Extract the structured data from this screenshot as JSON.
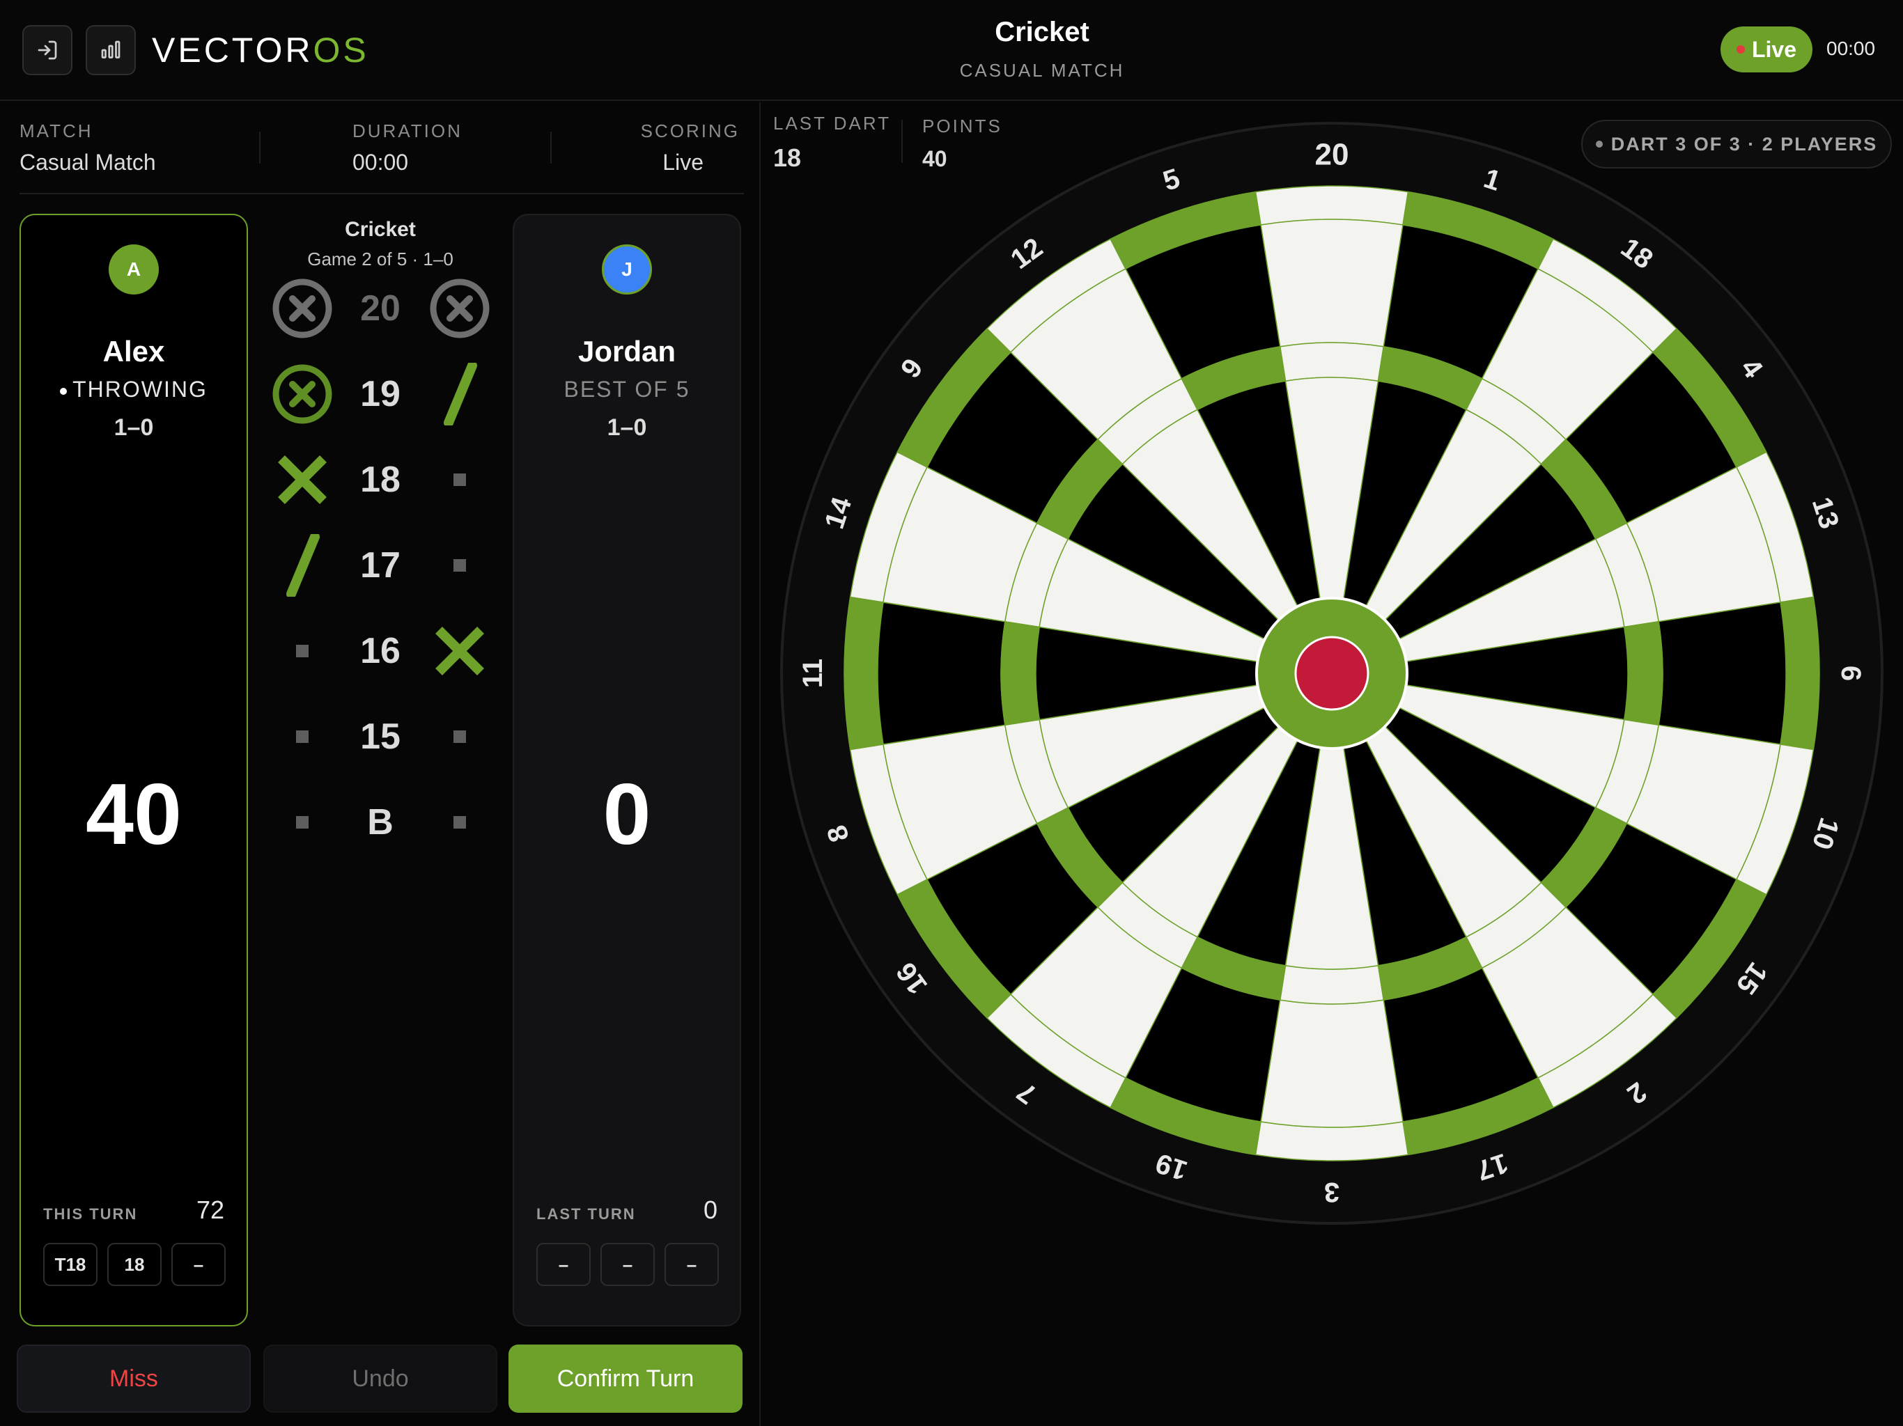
{
  "brand": {
    "part1": "VECTOR",
    "part2": "OS"
  },
  "header": {
    "title": "Cricket",
    "subtitle": "CASUAL MATCH",
    "live_label": "Live",
    "timer": "00:00"
  },
  "stats": [
    {
      "label": "MATCH",
      "value": "Casual Match"
    },
    {
      "label": "DURATION",
      "value": "00:00"
    },
    {
      "label": "SCORING",
      "value": "Live"
    }
  ],
  "players": [
    {
      "initial": "A",
      "name": "Alex",
      "status": "THROWING",
      "record": "1–0",
      "score": "40",
      "turn_label": "THIS TURN",
      "turn_total": "72",
      "darts": [
        "T18",
        "18",
        "–"
      ]
    },
    {
      "initial": "J",
      "name": "Jordan",
      "status": "BEST OF 5",
      "record": "1–0",
      "score": "0",
      "turn_label": "LAST TURN",
      "turn_total": "0",
      "darts": [
        "–",
        "–",
        "–"
      ]
    }
  ],
  "cricket": {
    "title": "Cricket",
    "subtitle": "Game 2 of 5 · 1–0",
    "rows": [
      {
        "number": "20",
        "left": "closed-gray",
        "right": "closed-gray"
      },
      {
        "number": "19",
        "left": "closed-green",
        "right": "slash"
      },
      {
        "number": "18",
        "left": "x",
        "right": "none"
      },
      {
        "number": "17",
        "left": "slash",
        "right": "none"
      },
      {
        "number": "16",
        "left": "none",
        "right": "x"
      },
      {
        "number": "15",
        "left": "none",
        "right": "none"
      },
      {
        "number": "B",
        "left": "none",
        "right": "none"
      }
    ]
  },
  "actions": {
    "miss": "Miss",
    "undo": "Undo",
    "confirm": "Confirm Turn"
  },
  "board_info": {
    "last_dart_label": "LAST DART",
    "last_dart_value": "18",
    "points_label": "POINTS",
    "points_value": "40",
    "dart_status": "DART 3 OF 3 · 2 PLAYERS"
  },
  "board": {
    "numbers": [
      "20",
      "1",
      "18",
      "4",
      "13",
      "6",
      "10",
      "15",
      "2",
      "17",
      "3",
      "19",
      "7",
      "16",
      "8",
      "11",
      "14",
      "9",
      "12",
      "5"
    ],
    "colors": {
      "accent": "#6da12a",
      "white": "#f3f3f0",
      "black": "#000000",
      "bullseye": "#c41a3a"
    }
  },
  "icons": {
    "exit": "exit-icon",
    "stats": "bar-chart-icon"
  }
}
